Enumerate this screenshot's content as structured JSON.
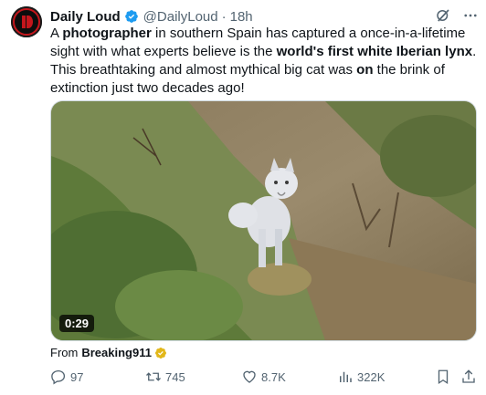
{
  "tweet": {
    "author_name": "Daily Loud",
    "handle": "@DailyLoud",
    "separator": "·",
    "time": "18h",
    "text_parts": [
      {
        "t": "A ",
        "b": false
      },
      {
        "t": "photographer",
        "b": true
      },
      {
        "t": " in southern Spain has captured a once-in-a-lifetime sight with what experts believe is the ",
        "b": false
      },
      {
        "t": "world's first white Iberian lynx",
        "b": true
      },
      {
        "t": ". This breathtaking and almost mythical big cat was ",
        "b": false
      },
      {
        "t": "on",
        "b": true
      },
      {
        "t": " the brink of extinction just two decades ago!",
        "b": false
      }
    ],
    "video_duration": "0:29",
    "from_label": "From",
    "from_source": "Breaking911"
  },
  "actions": {
    "replies": "97",
    "retweets": "745",
    "likes": "8.7K",
    "views": "322K"
  },
  "colors": {
    "verified_blue": "#1d9bf0",
    "verified_gold": "#e2b719",
    "muted": "#536471"
  }
}
